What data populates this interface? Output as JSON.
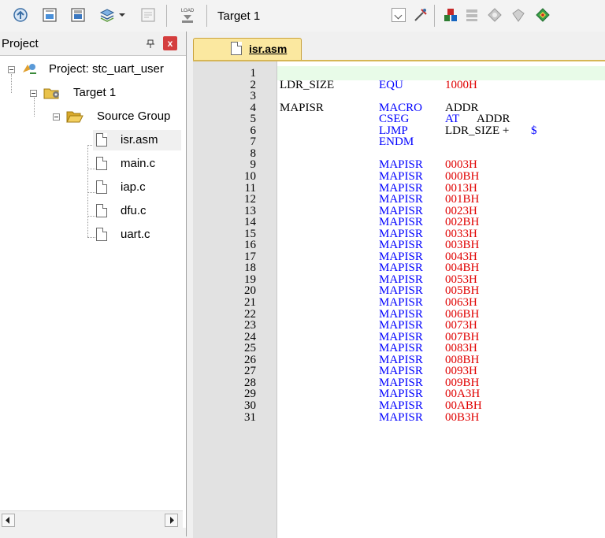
{
  "toolbar": {
    "target_label": "Target 1",
    "icons": [
      "build-icon",
      "rebuild-icon",
      "batch-build-icon",
      "translate-icon",
      "stop-build-icon",
      "load-icon",
      "target-options-icon",
      "manage-components-icon",
      "select-packs-icon",
      "pack-installer-icon",
      "runtime-env-icon",
      "layout-icon"
    ],
    "load_text": "LOAD"
  },
  "project_panel": {
    "title": "Project",
    "pin_glyph": "ⵕ",
    "close_glyph": "x",
    "tree": {
      "project": "Project: stc_uart_user",
      "target": "Target 1",
      "group": "Source Group",
      "files": [
        "isr.asm",
        "main.c",
        "iap.c",
        "dfu.c",
        "uart.c"
      ],
      "selected_index": 0
    }
  },
  "editor": {
    "tab_label": "isr.asm",
    "lines": [
      {
        "n": "1",
        "label": "",
        "op": "",
        "arg": "",
        "arg2": "",
        "arg_red": false
      },
      {
        "n": "2",
        "label": "LDR_SIZE",
        "op": "EQU",
        "arg": "1000H",
        "arg2": "",
        "arg_red": true
      },
      {
        "n": "3",
        "label": "",
        "op": "",
        "arg": "",
        "arg2": "",
        "arg_red": false
      },
      {
        "n": "4",
        "label": "MAPISR",
        "op": "MACRO",
        "arg": "ADDR",
        "arg2": "",
        "arg_red": false
      },
      {
        "n": "5",
        "label": "",
        "op": "CSEG",
        "arg": "AT",
        "arg2": "ADDR",
        "arg_red": false,
        "arg_blue": true
      },
      {
        "n": "6",
        "label": "",
        "op": "LJMP",
        "arg": "LDR_SIZE + ",
        "arg2": "",
        "arg_red": false,
        "dollar": "$"
      },
      {
        "n": "7",
        "label": "",
        "op": "ENDM",
        "arg": "",
        "arg2": "",
        "arg_red": false
      },
      {
        "n": "8",
        "label": "",
        "op": "",
        "arg": "",
        "arg2": "",
        "arg_red": false
      },
      {
        "n": "9",
        "label": "",
        "op": "MAPISR",
        "arg": "0003H",
        "arg2": "",
        "arg_red": true
      },
      {
        "n": "10",
        "label": "",
        "op": "MAPISR",
        "arg": "000BH",
        "arg2": "",
        "arg_red": true
      },
      {
        "n": "11",
        "label": "",
        "op": "MAPISR",
        "arg": "0013H",
        "arg2": "",
        "arg_red": true
      },
      {
        "n": "12",
        "label": "",
        "op": "MAPISR",
        "arg": "001BH",
        "arg2": "",
        "arg_red": true
      },
      {
        "n": "13",
        "label": "",
        "op": "MAPISR",
        "arg": "0023H",
        "arg2": "",
        "arg_red": true
      },
      {
        "n": "14",
        "label": "",
        "op": "MAPISR",
        "arg": "002BH",
        "arg2": "",
        "arg_red": true
      },
      {
        "n": "15",
        "label": "",
        "op": "MAPISR",
        "arg": "0033H",
        "arg2": "",
        "arg_red": true
      },
      {
        "n": "16",
        "label": "",
        "op": "MAPISR",
        "arg": "003BH",
        "arg2": "",
        "arg_red": true
      },
      {
        "n": "17",
        "label": "",
        "op": "MAPISR",
        "arg": "0043H",
        "arg2": "",
        "arg_red": true
      },
      {
        "n": "18",
        "label": "",
        "op": "MAPISR",
        "arg": "004BH",
        "arg2": "",
        "arg_red": true
      },
      {
        "n": "19",
        "label": "",
        "op": "MAPISR",
        "arg": "0053H",
        "arg2": "",
        "arg_red": true
      },
      {
        "n": "20",
        "label": "",
        "op": "MAPISR",
        "arg": "005BH",
        "arg2": "",
        "arg_red": true
      },
      {
        "n": "21",
        "label": "",
        "op": "MAPISR",
        "arg": "0063H",
        "arg2": "",
        "arg_red": true
      },
      {
        "n": "22",
        "label": "",
        "op": "MAPISR",
        "arg": "006BH",
        "arg2": "",
        "arg_red": true
      },
      {
        "n": "23",
        "label": "",
        "op": "MAPISR",
        "arg": "0073H",
        "arg2": "",
        "arg_red": true
      },
      {
        "n": "24",
        "label": "",
        "op": "MAPISR",
        "arg": "007BH",
        "arg2": "",
        "arg_red": true
      },
      {
        "n": "25",
        "label": "",
        "op": "MAPISR",
        "arg": "0083H",
        "arg2": "",
        "arg_red": true
      },
      {
        "n": "26",
        "label": "",
        "op": "MAPISR",
        "arg": "008BH",
        "arg2": "",
        "arg_red": true
      },
      {
        "n": "27",
        "label": "",
        "op": "MAPISR",
        "arg": "0093H",
        "arg2": "",
        "arg_red": true
      },
      {
        "n": "28",
        "label": "",
        "op": "MAPISR",
        "arg": "009BH",
        "arg2": "",
        "arg_red": true
      },
      {
        "n": "29",
        "label": "",
        "op": "MAPISR",
        "arg": "00A3H",
        "arg2": "",
        "arg_red": true
      },
      {
        "n": "30",
        "label": "",
        "op": "MAPISR",
        "arg": "00ABH",
        "arg2": "",
        "arg_red": true
      },
      {
        "n": "31",
        "label": "",
        "op": "MAPISR",
        "arg": "00B3H",
        "arg2": "",
        "arg_red": true
      }
    ]
  },
  "colors": {
    "keyword": "#0000ff",
    "number": "#e00000",
    "tab": "#fbe8a0",
    "current_line": "#e8fbe8"
  }
}
